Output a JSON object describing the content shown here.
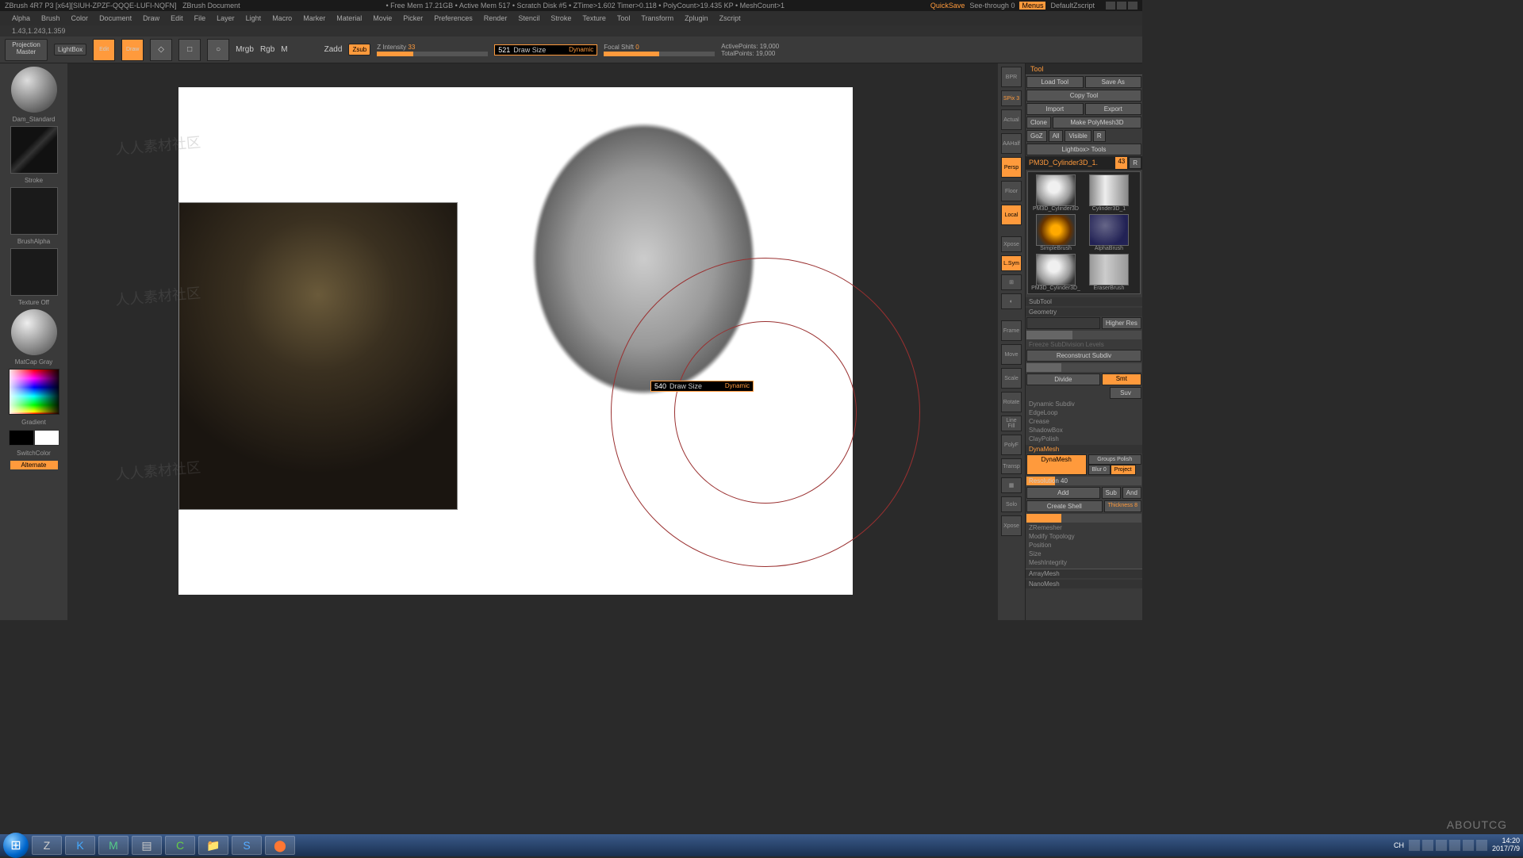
{
  "titlebar": {
    "app": "ZBrush 4R7 P3 [x64][SIUH-ZPZF-QQQE-LUFI-NQFN]",
    "doc": "ZBrush Document",
    "stats": "• Free Mem 17.21GB • Active Mem 517 • Scratch Disk #5 • ZTime>1.602 Timer>0.118 • PolyCount>19.435 KP • MeshCount>1",
    "quicksave": "QuickSave",
    "seethrough": "See-through 0",
    "menus": "Menus",
    "script": "DefaultZscript"
  },
  "menu": [
    "Alpha",
    "Brush",
    "Color",
    "Document",
    "Draw",
    "Edit",
    "File",
    "Layer",
    "Light",
    "Macro",
    "Marker",
    "Material",
    "Movie",
    "Picker",
    "Preferences",
    "Render",
    "Stencil",
    "Stroke",
    "Texture",
    "Tool",
    "Transform",
    "Zplugin",
    "Zscript"
  ],
  "coords": "1.43,1.243,1.359",
  "toolbar": {
    "projection": "Projection\nMaster",
    "lightbox": "LightBox",
    "edit": "Edit",
    "draw": "Draw",
    "mrgb": "Mrgb",
    "rgb": "Rgb",
    "m": "M",
    "zadd": "Zadd",
    "zsub": "Zsub",
    "zintensity": "Z Intensity",
    "zintensity_val": "33",
    "focal": "Focal Shift",
    "focal_val": "0",
    "drawsize_val": "521",
    "drawsize_lbl": "Draw Size",
    "dynamic": "Dynamic",
    "active": "ActivePoints: 19,000",
    "total": "TotalPoints: 19,000"
  },
  "left": {
    "brush": "Dam_Standard",
    "stroke": "Stroke",
    "alpha": "BrushAlpha",
    "texture": "Texture Off",
    "matcap": "MatCap Gray",
    "gradient": "Gradient",
    "switchcolor": "SwitchColor",
    "alternate": "Alternate"
  },
  "canvas_popup": {
    "val": "540",
    "lbl": "Draw Size",
    "dyn": "Dynamic"
  },
  "shelf": [
    "BPR",
    "SPix 3",
    "Actual",
    "AAHalf",
    "Persp",
    "Floor",
    "Local",
    "Xpose",
    "L.Sym",
    "Frame",
    "Move",
    "Scale",
    "Rotate",
    "Line Fill",
    "PolyF",
    "Transp",
    "Ghost",
    "Solo",
    "Xpose"
  ],
  "tool": {
    "title": "Tool",
    "load": "Load Tool",
    "save": "Save As",
    "copy": "Copy Tool",
    "import": "Import",
    "export": "Export",
    "clone": "Clone",
    "make": "Make PolyMesh3D",
    "goz": "GoZ",
    "all": "All",
    "visible": "Visible",
    "r": "R",
    "lightbox_tools": "Lightbox> Tools",
    "current": "PM3D_Cylinder3D_1.",
    "cur_idx": "43",
    "items": [
      {
        "label": "PM3D_Cylinder3D",
        "cls": "head"
      },
      {
        "label": "Cylinder3D_1",
        "cls": "cyl"
      },
      {
        "label": "SimpleBrush",
        "cls": "spiral"
      },
      {
        "label": "AlphaBrush",
        "cls": "sphere"
      },
      {
        "label": "PM3D_Cylinder3D_",
        "cls": "head"
      },
      {
        "label": "EraserBrush",
        "cls": "eraser"
      }
    ],
    "subtool": "SubTool",
    "geometry": "Geometry",
    "higher": "Higher Res",
    "reconstruct": "Reconstruct Subdiv",
    "divide": "Divide",
    "smt": "Smt",
    "suv": "Suv",
    "dynsub": "Dynamic Subdiv",
    "edgeloop": "EdgeLoop",
    "crease": "Crease",
    "shadowbox": "ShadowBox",
    "claypolish": "ClayPolish",
    "dynamesh_hdr": "DynaMesh",
    "dynamesh": "DynaMesh",
    "groups": "Groups Polish",
    "blur": "Blur 0",
    "project": "Project",
    "resolution": "Resolution 40",
    "add": "Add",
    "sub": "Sub",
    "and": "And",
    "createshell": "Create Shell",
    "thickness": "Thickness 8",
    "zremesher": "ZRemesher",
    "modify": "Modify Topology",
    "position": "Position",
    "size": "Size",
    "meshintegrity": "MeshIntegrity",
    "arraymesh": "ArrayMesh",
    "nanomesh": "NanoMesh"
  },
  "taskbar": {
    "time": "14:20",
    "date": "2017/7/9"
  },
  "watermark": "ABOUTCG",
  "wm_repeat": "人人素材社区"
}
